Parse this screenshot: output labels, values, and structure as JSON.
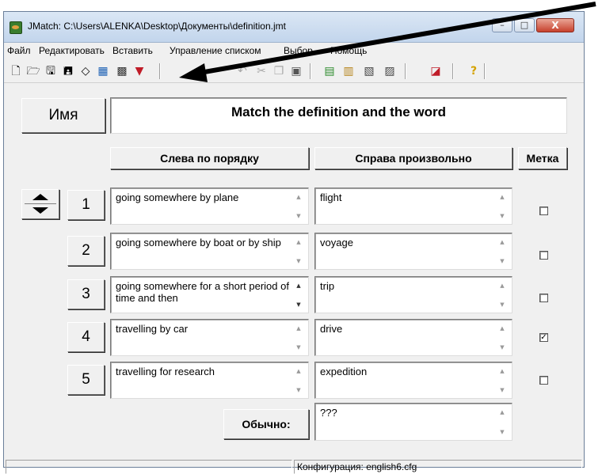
{
  "window": {
    "title": "JMatch: C:\\Users\\ALENKA\\Desktop\\Документы\\definition.jmt",
    "buttons": {
      "minimize": "–",
      "maximize": "□",
      "close": "X"
    }
  },
  "menu": {
    "items": [
      "Файл",
      "Редактировать",
      "Вставить",
      "Управление списком",
      "Выбор",
      "Помощь"
    ]
  },
  "toolbar": {
    "icons": [
      "new-file-icon",
      "open-folder-icon",
      "save-icon",
      "save-as-icon",
      "eraser-icon",
      "export-html-icon",
      "export-html6-icon",
      "red-marker-icon",
      "undo-icon",
      "cut-icon",
      "copy-icon",
      "paste-icon",
      "tool-a-icon",
      "tool-b-icon",
      "tool-c-icon",
      "tool-d-icon",
      "config-icon",
      "help-icon"
    ]
  },
  "header": {
    "name_label": "Имя",
    "title_value": "Match the definition and the word"
  },
  "columns": {
    "left": "Слева по порядку",
    "right": "Справа произвольно",
    "mark": "Метка"
  },
  "rows": [
    {
      "num": "1",
      "left": "going somewhere by plane",
      "right": "flight",
      "checked": false
    },
    {
      "num": "2",
      "left": "going somewhere by boat or by ship",
      "right": "voyage",
      "checked": false
    },
    {
      "num": "3",
      "left": "going somewhere for a short period of time and then",
      "right": "trip",
      "checked": false
    },
    {
      "num": "4",
      "left": "travelling by car",
      "right": "drive",
      "checked": true
    },
    {
      "num": "5",
      "left": "travelling for research",
      "right": "expedition",
      "checked": false
    }
  ],
  "default": {
    "label": "Обычно:",
    "value": "???"
  },
  "status": {
    "config": "Конфигурация: english6.cfg"
  }
}
